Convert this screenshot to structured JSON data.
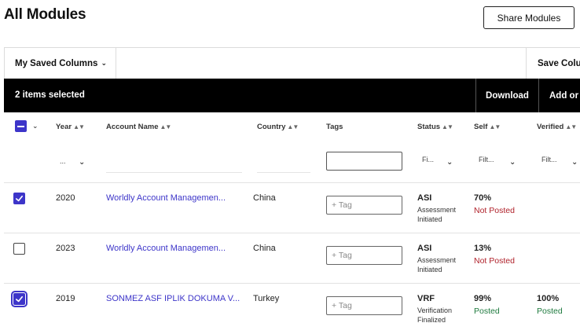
{
  "page": {
    "title": "All Modules"
  },
  "header": {
    "share_label": "Share Modules"
  },
  "toolbar": {
    "saved_columns_label": "My Saved Columns",
    "save_columns_label": "Save Colu"
  },
  "selection_bar": {
    "count_label": "2 items selected",
    "download_label": "Download",
    "add_label": "Add or"
  },
  "columns": {
    "year": "Year",
    "account_name": "Account Name",
    "country": "Country",
    "tags": "Tags",
    "status": "Status",
    "self": "Self",
    "verified": "Verified"
  },
  "filters": {
    "year_placeholder": "...",
    "status_placeholder": "Fi...",
    "self_placeholder": "Filt...",
    "verified_placeholder": "Filt..."
  },
  "rows": [
    {
      "selected": true,
      "year": "2020",
      "account": "Worldly Account Managemen...",
      "country": "China",
      "tag_placeholder": "+ Tag",
      "status_code": "ASI",
      "status_desc": "Assessment Initiated",
      "self_pct": "70%",
      "self_state": "Not Posted",
      "verified_pct": "",
      "verified_state": ""
    },
    {
      "selected": false,
      "year": "2023",
      "account": "Worldly Account Managemen...",
      "country": "China",
      "tag_placeholder": "+ Tag",
      "status_code": "ASI",
      "status_desc": "Assessment Initiated",
      "self_pct": "13%",
      "self_state": "Not Posted",
      "verified_pct": "",
      "verified_state": ""
    },
    {
      "selected": true,
      "year": "2019",
      "account": "SONMEZ ASF IPLIK DOKUMA V...",
      "country": "Turkey",
      "tag_placeholder": "+ Tag",
      "status_code": "VRF",
      "status_desc": "Verification Finalized",
      "self_pct": "99%",
      "self_state": "Posted",
      "verified_pct": "100%",
      "verified_state": "Posted"
    }
  ],
  "colors": {
    "accent": "#3d35c9",
    "not_posted": "#b0222b",
    "posted": "#1e7a3e"
  },
  "icons": {
    "checkbox_checked": "check-icon",
    "chevron": "chevron-down-icon",
    "sort": "sort-icon"
  }
}
